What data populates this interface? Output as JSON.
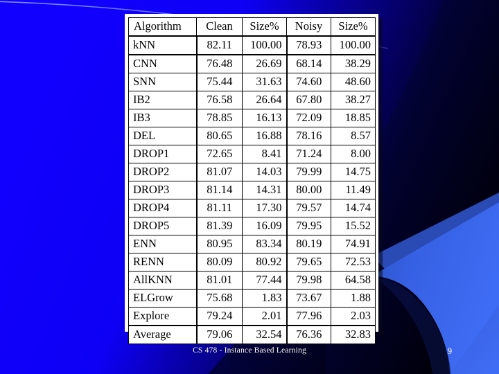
{
  "slide": {
    "footer_text": "CS 478 - Instance Based Learning",
    "page_number": "9"
  },
  "colors": {
    "background_blue": "#0d00ff",
    "background_navy": "#000033",
    "background_dark": "#020213",
    "wedge_blue": "#3a66ee",
    "wedge_blue_dark": "#2f54c6",
    "arc_line": "#5b7bff",
    "table_background": "#ffffff",
    "table_border": "#000000",
    "text_white": "#ffffff"
  },
  "table": {
    "columns": [
      "Algorithm",
      "Clean",
      "Size%",
      "Noisy",
      "Size%"
    ],
    "rows": [
      {
        "algorithm": "kNN",
        "clean": "82.11",
        "size_clean": "100.00",
        "noisy": "78.93",
        "size_noisy": "100.00"
      },
      {
        "algorithm": "CNN",
        "clean": "76.48",
        "size_clean": "26.69",
        "noisy": "68.14",
        "size_noisy": "38.29"
      },
      {
        "algorithm": "SNN",
        "clean": "75.44",
        "size_clean": "31.63",
        "noisy": "74.60",
        "size_noisy": "48.60"
      },
      {
        "algorithm": "IB2",
        "clean": "76.58",
        "size_clean": "26.64",
        "noisy": "67.80",
        "size_noisy": "38.27"
      },
      {
        "algorithm": "IB3",
        "clean": "78.85",
        "size_clean": "16.13",
        "noisy": "72.09",
        "size_noisy": "18.85"
      },
      {
        "algorithm": "DEL",
        "clean": "80.65",
        "size_clean": "16.88",
        "noisy": "78.16",
        "size_noisy": "8.57"
      },
      {
        "algorithm": "DROP1",
        "clean": "72.65",
        "size_clean": "8.41",
        "noisy": "71.24",
        "size_noisy": "8.00"
      },
      {
        "algorithm": "DROP2",
        "clean": "81.07",
        "size_clean": "14.03",
        "noisy": "79.99",
        "size_noisy": "14.75"
      },
      {
        "algorithm": "DROP3",
        "clean": "81.14",
        "size_clean": "14.31",
        "noisy": "80.00",
        "size_noisy": "11.49"
      },
      {
        "algorithm": "DROP4",
        "clean": "81.11",
        "size_clean": "17.30",
        "noisy": "79.57",
        "size_noisy": "14.74"
      },
      {
        "algorithm": "DROP5",
        "clean": "81.39",
        "size_clean": "16.09",
        "noisy": "79.95",
        "size_noisy": "15.52"
      },
      {
        "algorithm": "ENN",
        "clean": "80.95",
        "size_clean": "83.34",
        "noisy": "80.19",
        "size_noisy": "74.91"
      },
      {
        "algorithm": "RENN",
        "clean": "80.09",
        "size_clean": "80.92",
        "noisy": "79.65",
        "size_noisy": "72.53"
      },
      {
        "algorithm": "AllKNN",
        "clean": "81.01",
        "size_clean": "77.44",
        "noisy": "79.98",
        "size_noisy": "64.58"
      },
      {
        "algorithm": "ELGrow",
        "clean": "75.68",
        "size_clean": "1.83",
        "noisy": "73.67",
        "size_noisy": "1.88"
      },
      {
        "algorithm": "Explore",
        "clean": "79.24",
        "size_clean": "2.01",
        "noisy": "77.96",
        "size_noisy": "2.03"
      },
      {
        "algorithm": "Average",
        "clean": "79.06",
        "size_clean": "32.54",
        "noisy": "76.36",
        "size_noisy": "32.83"
      }
    ]
  }
}
